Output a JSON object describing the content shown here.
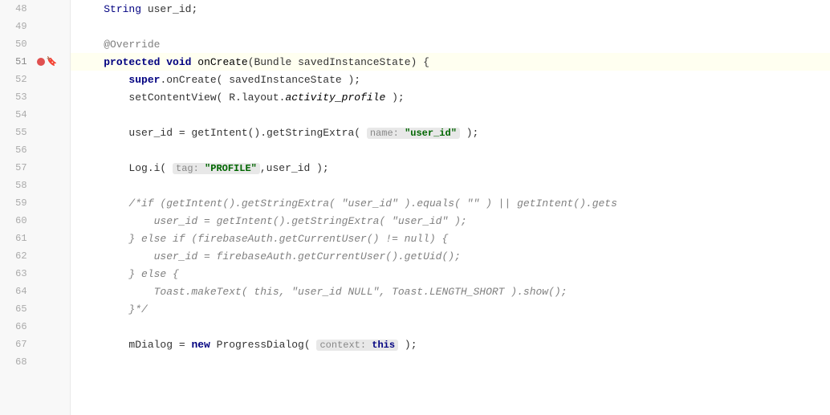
{
  "editor": {
    "lines": [
      {
        "num": 48,
        "content": "string_user_id",
        "type": "code"
      },
      {
        "num": 49,
        "content": "",
        "type": "empty"
      },
      {
        "num": 50,
        "content": "@Override",
        "type": "annotation"
      },
      {
        "num": 51,
        "content": "protected_void_onCreate",
        "type": "method_decl",
        "breakpoint": true,
        "bookmark": true
      },
      {
        "num": 52,
        "content": "super_onCreate",
        "type": "super_call"
      },
      {
        "num": 53,
        "content": "setContentView",
        "type": "setcontentview"
      },
      {
        "num": 54,
        "content": "",
        "type": "empty"
      },
      {
        "num": 55,
        "content": "user_id_getIntent",
        "type": "user_id_assign"
      },
      {
        "num": 56,
        "content": "",
        "type": "empty"
      },
      {
        "num": 57,
        "content": "log_i",
        "type": "log_call"
      },
      {
        "num": 58,
        "content": "",
        "type": "empty"
      },
      {
        "num": 59,
        "content": "comment_if_getIntent",
        "type": "comment"
      },
      {
        "num": 60,
        "content": "comment_user_id_1",
        "type": "comment"
      },
      {
        "num": 61,
        "content": "comment_else_if",
        "type": "comment"
      },
      {
        "num": 62,
        "content": "comment_user_id_2",
        "type": "comment"
      },
      {
        "num": 63,
        "content": "comment_else",
        "type": "comment"
      },
      {
        "num": 64,
        "content": "comment_toast",
        "type": "comment"
      },
      {
        "num": 65,
        "content": "comment_close",
        "type": "comment"
      },
      {
        "num": 66,
        "content": "",
        "type": "empty"
      },
      {
        "num": 67,
        "content": "mDialog_new",
        "type": "mdialog"
      },
      {
        "num": 68,
        "content": "",
        "type": "empty"
      }
    ],
    "accent_color": "#e05050"
  }
}
